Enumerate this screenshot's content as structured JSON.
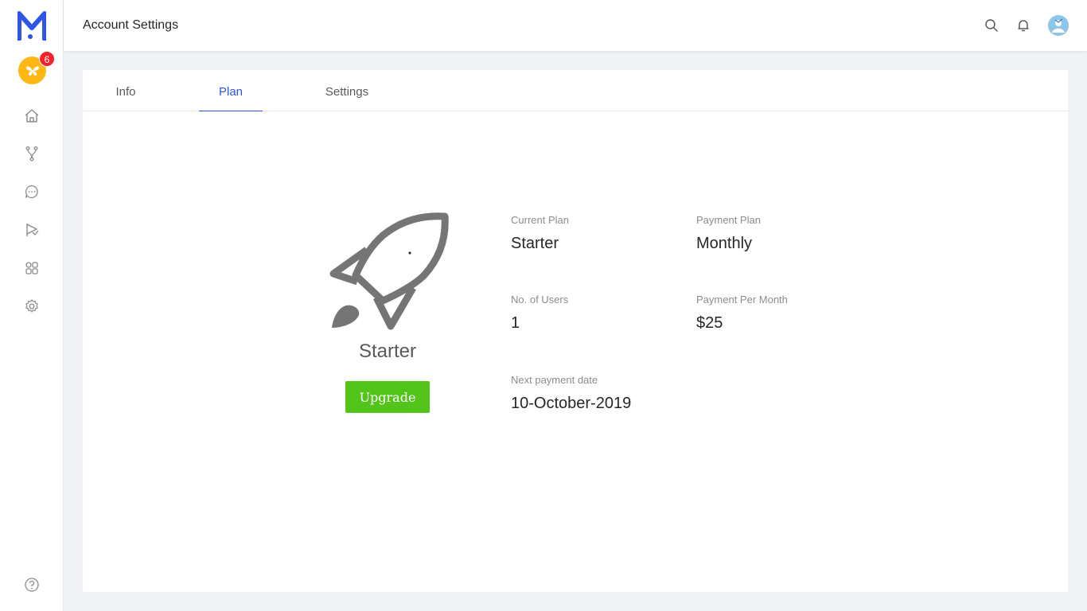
{
  "sidebar": {
    "workspace_badge": "6",
    "nav": [
      "home",
      "branches",
      "chat",
      "campaigns",
      "apps",
      "settings"
    ],
    "help": "help"
  },
  "header": {
    "title": "Account Settings"
  },
  "tabs": [
    {
      "label": "Info",
      "active": false
    },
    {
      "label": "Plan",
      "active": true
    },
    {
      "label": "Settings",
      "active": false
    }
  ],
  "plan": {
    "name": "Starter",
    "upgrade_label": "Upgrade",
    "fields": {
      "current_plan": {
        "label": "Current Plan",
        "value": "Starter"
      },
      "payment_plan": {
        "label": "Payment Plan",
        "value": "Monthly"
      },
      "users": {
        "label": "No. of Users",
        "value": "1"
      },
      "payment_per_month": {
        "label": "Payment Per Month",
        "value": "$25"
      },
      "next_payment": {
        "label": "Next payment date",
        "value": "10-October-2019"
      }
    }
  },
  "colors": {
    "brand": "#2f54eb",
    "upgrade": "#52c41a",
    "badge": "#f5222d",
    "workspace": "#fdb813"
  }
}
